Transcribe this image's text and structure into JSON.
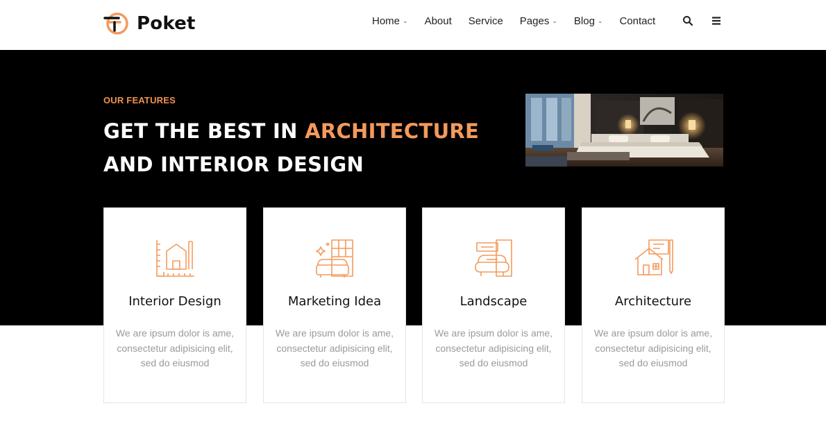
{
  "brand": {
    "name": "Poket",
    "accent_color": "#f39a5c"
  },
  "nav": {
    "items": [
      {
        "label": "Home",
        "dropdown": true
      },
      {
        "label": "About",
        "dropdown": false
      },
      {
        "label": "Service",
        "dropdown": false
      },
      {
        "label": "Pages",
        "dropdown": true
      },
      {
        "label": "Blog",
        "dropdown": true
      },
      {
        "label": "Contact",
        "dropdown": false
      }
    ],
    "icons": [
      "search-icon",
      "menu-icon"
    ]
  },
  "hero": {
    "eyebrow": "OUR FEATURES",
    "headline_part1": "GET THE BEST IN ",
    "headline_accent": "ARCHITECTURE",
    "headline_part2": "AND INTERIOR DESIGN",
    "background_color": "#000000"
  },
  "features": [
    {
      "icon": "floor-plan-icon",
      "title": "Interior Design",
      "text": "We are ipsum dolor is ame, consectetur adipisicing elit, sed do eiusmod"
    },
    {
      "icon": "furniture-icon",
      "title": "Marketing Idea",
      "text": "We are ipsum dolor is ame, consectetur adipisicing elit, sed do eiusmod"
    },
    {
      "icon": "armchair-icon",
      "title": "Landscape",
      "text": "We are ipsum dolor is ame, consectetur adipisicing elit, sed do eiusmod"
    },
    {
      "icon": "house-blueprint-icon",
      "title": "Architecture",
      "text": "We are ipsum dolor is ame, consectetur adipisicing elit, sed do eiusmod"
    }
  ]
}
